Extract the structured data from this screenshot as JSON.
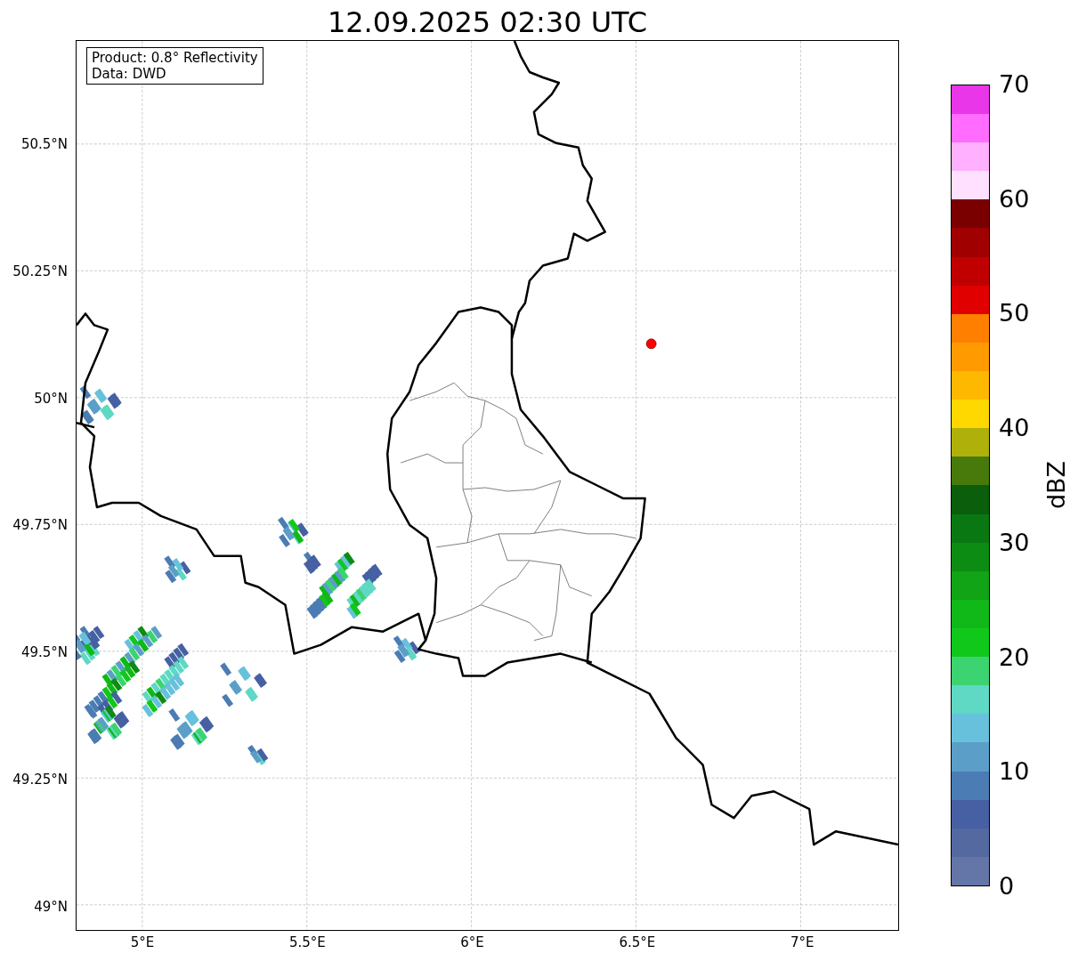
{
  "title": "12.09.2025 02:30 UTC",
  "info_box": {
    "lines": [
      "Product: 0.8° Reflectivity",
      "Data: DWD"
    ]
  },
  "map": {
    "lat_labels": [
      "50.5°N",
      "50.25°N",
      "50°N",
      "49.75°N",
      "49.5°N",
      "49.25°N",
      "49°N"
    ],
    "lon_labels": [
      "5°E",
      "5.5°E",
      "6°E",
      "6.5°E",
      "7°E"
    ]
  },
  "colorbar": {
    "label": "dBZ",
    "ticks": [
      "70",
      "60",
      "50",
      "40",
      "30",
      "20",
      "10",
      "0"
    ],
    "bins": [
      {
        "color": "#6475a7"
      },
      {
        "color": "#5469a0"
      },
      {
        "color": "#4660a3"
      },
      {
        "color": "#4b7cb3"
      },
      {
        "color": "#5b9fc8"
      },
      {
        "color": "#67c1dc"
      },
      {
        "color": "#5fd8c4"
      },
      {
        "color": "#3cd470"
      },
      {
        "color": "#10c81a"
      },
      {
        "color": "#10b818"
      },
      {
        "color": "#10a416"
      },
      {
        "color": "#0c8c12"
      },
      {
        "color": "#0a7812"
      },
      {
        "color": "#0a5e0c"
      },
      {
        "color": "#477a0b"
      },
      {
        "color": "#b0b00a"
      },
      {
        "color": "#ffd800"
      },
      {
        "color": "#ffb800"
      },
      {
        "color": "#ff9a00"
      },
      {
        "color": "#ff7f00"
      },
      {
        "color": "#e00000"
      },
      {
        "color": "#c00000"
      },
      {
        "color": "#a00000"
      },
      {
        "color": "#7a0000"
      },
      {
        "color": "#ffe0ff"
      },
      {
        "color": "#ffb0ff"
      },
      {
        "color": "#ff6cff"
      },
      {
        "color": "#e836e8"
      }
    ]
  }
}
